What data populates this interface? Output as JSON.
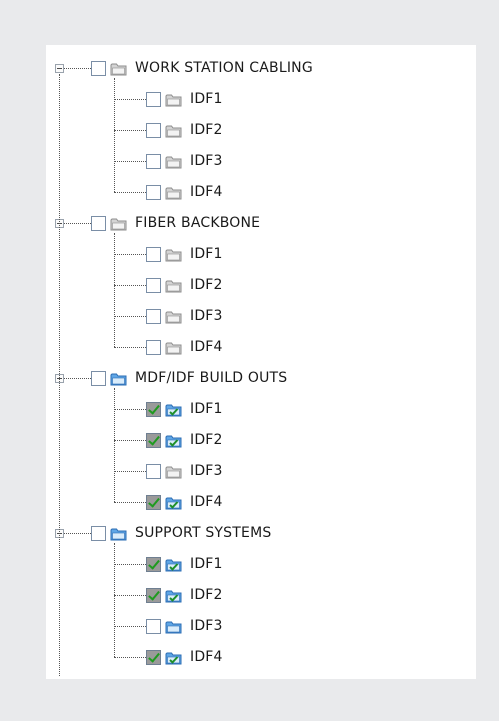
{
  "tree": [
    {
      "label": "WORK STATION CABLING",
      "checked": false,
      "folder": "gray",
      "children": [
        {
          "label": "IDF1",
          "checked": false,
          "folder": "gray"
        },
        {
          "label": "IDF2",
          "checked": false,
          "folder": "gray"
        },
        {
          "label": "IDF3",
          "checked": false,
          "folder": "gray"
        },
        {
          "label": "IDF4",
          "checked": false,
          "folder": "gray"
        }
      ]
    },
    {
      "label": "FIBER BACKBONE",
      "checked": false,
      "folder": "gray",
      "children": [
        {
          "label": "IDF1",
          "checked": false,
          "folder": "gray"
        },
        {
          "label": "IDF2",
          "checked": false,
          "folder": "gray"
        },
        {
          "label": "IDF3",
          "checked": false,
          "folder": "gray"
        },
        {
          "label": "IDF4",
          "checked": false,
          "folder": "gray"
        }
      ]
    },
    {
      "label": "MDF/IDF BUILD OUTS",
      "checked": false,
      "folder": "blue",
      "children": [
        {
          "label": "IDF1",
          "checked": true,
          "folder": "blue-check"
        },
        {
          "label": "IDF2",
          "checked": true,
          "folder": "blue-check"
        },
        {
          "label": "IDF3",
          "checked": false,
          "folder": "gray"
        },
        {
          "label": "IDF4",
          "checked": true,
          "folder": "blue-check"
        }
      ]
    },
    {
      "label": "SUPPORT SYSTEMS",
      "checked": false,
      "folder": "blue",
      "children": [
        {
          "label": "IDF1",
          "checked": true,
          "folder": "blue-check"
        },
        {
          "label": "IDF2",
          "checked": true,
          "folder": "blue-check"
        },
        {
          "label": "IDF3",
          "checked": false,
          "folder": "blue"
        },
        {
          "label": "IDF4",
          "checked": true,
          "folder": "blue-check"
        }
      ]
    }
  ],
  "colors": {
    "page_bg": "#e9eaec",
    "panel_bg": "#ffffff",
    "check_green": "#1f9a1f",
    "folder_gray": "#c9c9c9",
    "folder_blue": "#4a90d9"
  }
}
